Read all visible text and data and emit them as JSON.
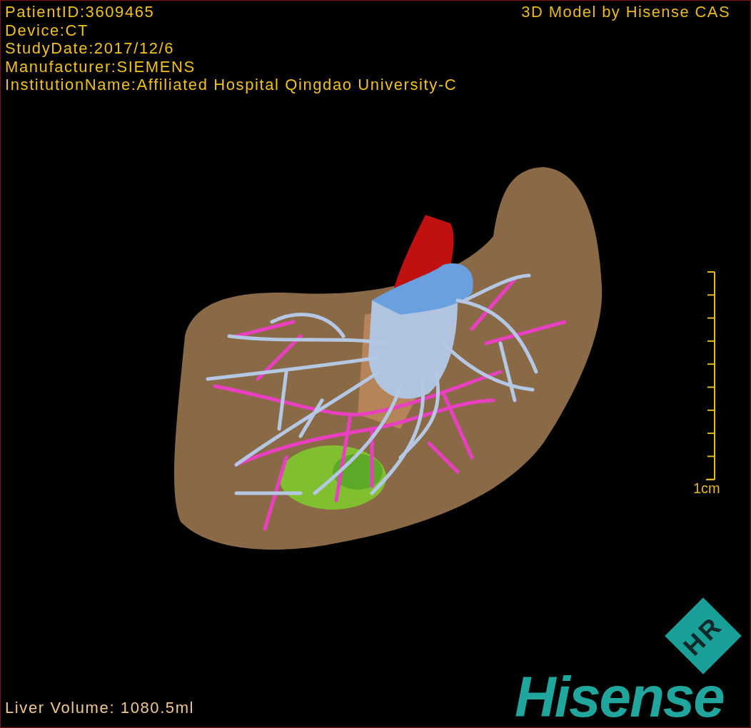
{
  "info_lines": [
    "PatientID:3609465",
    "Device:CT",
    "StudyDate:2017/12/6",
    "Manufacturer:SIEMENS",
    "InstitutionName:Affiliated Hospital Qingdao University-C"
  ],
  "credit": "3D Model by Hisense CAS",
  "scale_bar": {
    "label": "1cm"
  },
  "liver_volume": "Liver Volume: 1080.5ml",
  "logo": {
    "badge": "HR",
    "wordmark": "Hisense"
  }
}
